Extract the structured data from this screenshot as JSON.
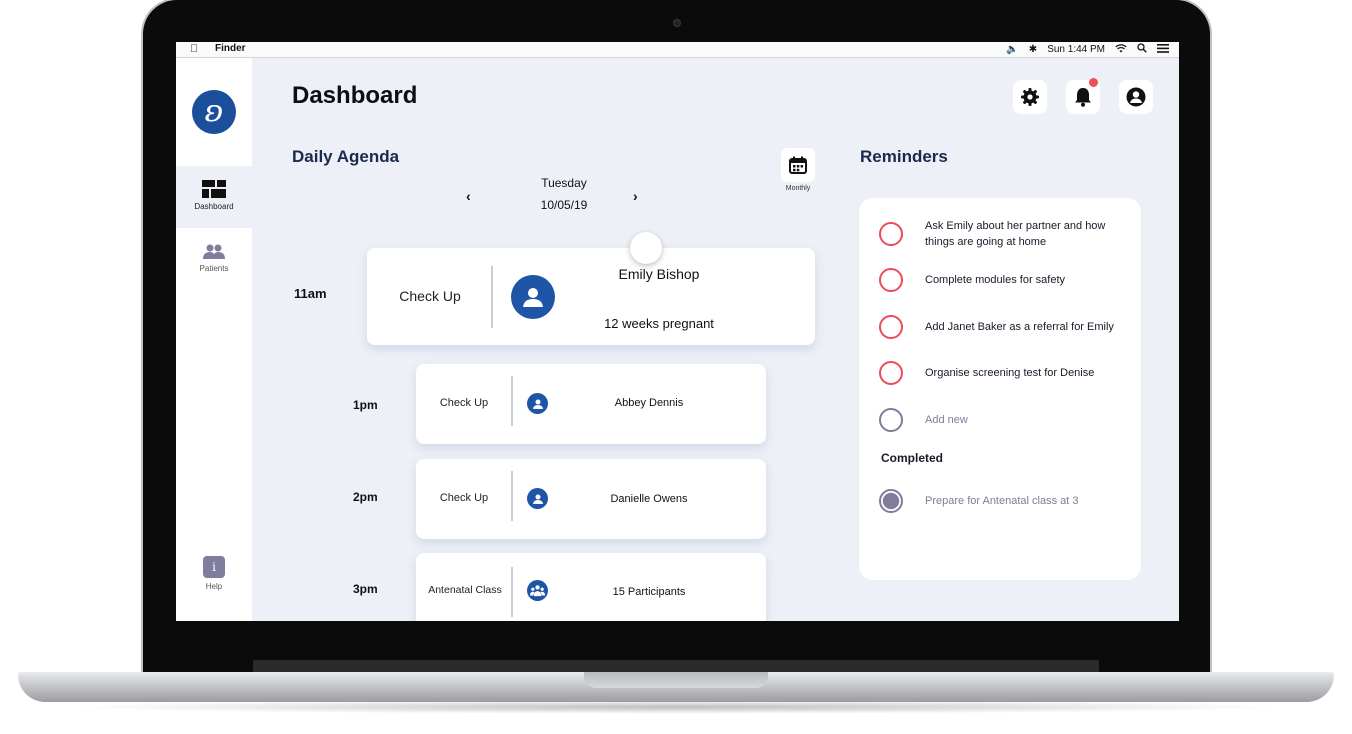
{
  "menubar": {
    "app_name": "Finder",
    "clock": "Sun 1:44 PM"
  },
  "sidebar": {
    "items": [
      {
        "label": "Dashboard",
        "icon": "dashboard-icon"
      },
      {
        "label": "Patients",
        "icon": "patients-icon"
      }
    ],
    "help_label": "Help"
  },
  "header": {
    "title": "Dashboard"
  },
  "agenda": {
    "title": "Daily Agenda",
    "day": "Tuesday",
    "date": "10/05/19",
    "monthly_label": "Monthly",
    "appointments": [
      {
        "time": "11am",
        "type": "Check Up",
        "name": "Emily Bishop",
        "detail": "12 weeks pregnant"
      },
      {
        "time": "1pm",
        "type": "Check Up",
        "name": "Abbey Dennis"
      },
      {
        "time": "2pm",
        "type": "Check Up",
        "name": "Danielle Owens"
      },
      {
        "time": "3pm",
        "type": "Antenatal Class",
        "name": "15 Participants"
      }
    ]
  },
  "reminders": {
    "title": "Reminders",
    "items": [
      "Ask Emily about her partner and how things are going at home",
      "Complete modules for safety",
      "Add Janet Baker as a referral for Emily",
      "Organise screening test for Denise"
    ],
    "add_new": "Add new",
    "completed_label": "Completed",
    "completed": [
      "Prepare for Antenatal class at 3"
    ]
  },
  "colors": {
    "brand_blue": "#1f55a6",
    "reminder_red": "#ee4a57",
    "muted_purple": "#7f7c9c",
    "notification_dot": "#f04f58"
  }
}
